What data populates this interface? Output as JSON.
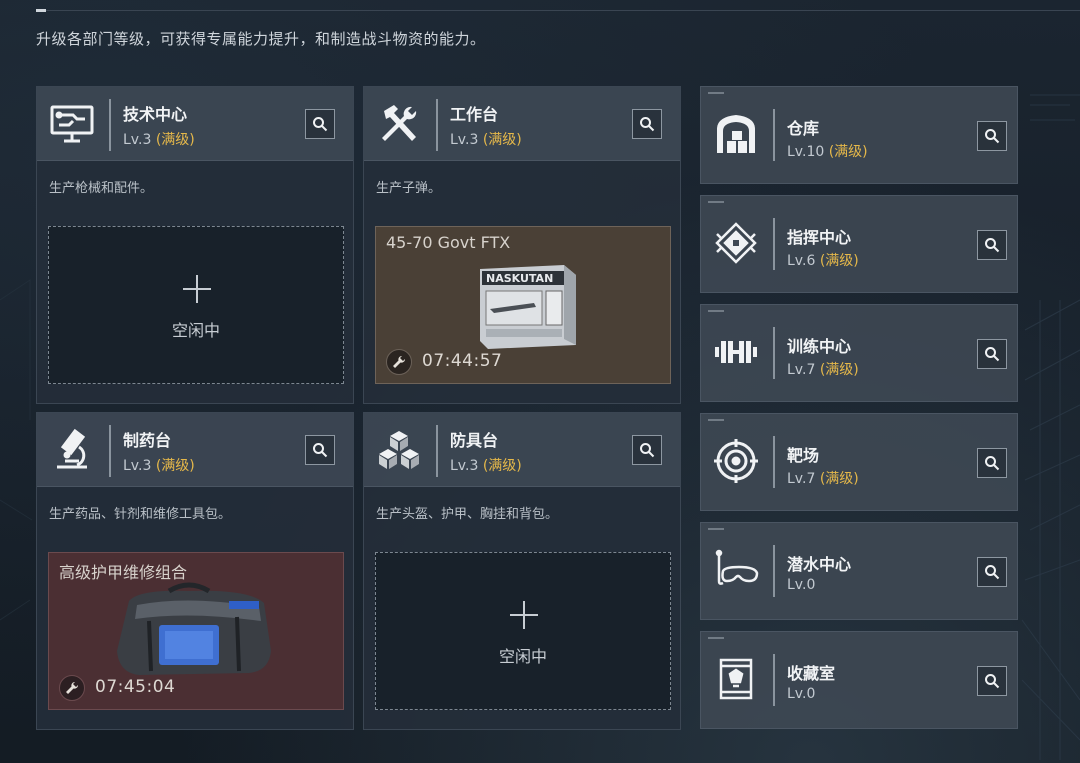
{
  "header": {
    "subtitle": "升级各部门等级，可获得专属能力提升，和制造战斗物资的能力。"
  },
  "departments": {
    "tech": {
      "name": "技术中心",
      "level": "Lv.3",
      "status": "(满级)",
      "desc": "生产枪械和配件。",
      "slot_state": "空闲中",
      "icon": "monitor-circuit-icon"
    },
    "workbench": {
      "name": "工作台",
      "level": "Lv.3",
      "status": "(满级)",
      "desc": "生产子弹。",
      "craft_item": "45-70 Govt FTX",
      "craft_timer": "07:44:57",
      "icon": "hammer-wrench-icon",
      "ammo_box_label": "NASKUTAN"
    },
    "pharmacy": {
      "name": "制药台",
      "level": "Lv.3",
      "status": "(满级)",
      "desc": "生产药品、针剂和维修工具包。",
      "craft_item": "高级护甲维修组合",
      "craft_timer": "07:45:04",
      "icon": "microscope-icon"
    },
    "armor": {
      "name": "防具台",
      "level": "Lv.3",
      "status": "(满级)",
      "desc": "生产头盔、护甲、胸挂和背包。",
      "slot_state": "空闲中",
      "icon": "cubes-icon"
    },
    "warehouse": {
      "name": "仓库",
      "level": "Lv.10",
      "status": "(满级)",
      "icon": "warehouse-icon"
    },
    "command": {
      "name": "指挥中心",
      "level": "Lv.6",
      "status": "(满级)",
      "icon": "command-emblem-icon"
    },
    "training": {
      "name": "训练中心",
      "level": "Lv.7",
      "status": "(满级)",
      "icon": "dumbbell-icon"
    },
    "range": {
      "name": "靶场",
      "level": "Lv.7",
      "status": "(满级)",
      "icon": "target-icon"
    },
    "diving": {
      "name": "潜水中心",
      "level": "Lv.0",
      "status": "",
      "icon": "dive-mask-icon"
    },
    "collection": {
      "name": "收藏室",
      "level": "Lv.0",
      "status": "",
      "icon": "display-case-icon"
    }
  },
  "colors": {
    "maxed": "#e5b84a",
    "ammo_slot_bg": "#4a4036",
    "medkit_slot_bg": "#4b2f33",
    "background": "#17202a"
  }
}
